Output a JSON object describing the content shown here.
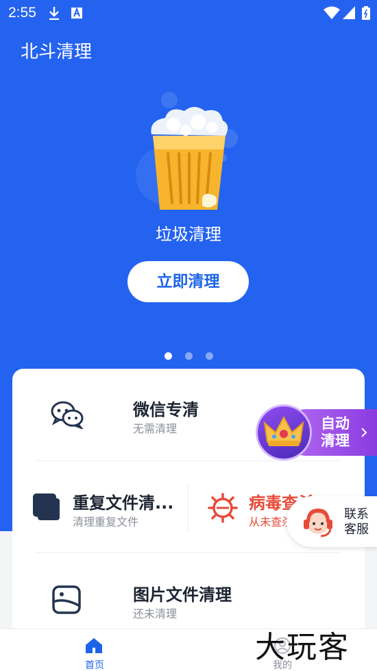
{
  "status_bar": {
    "time": "2:55",
    "icons": [
      "download-icon",
      "font-icon",
      "wifi-icon",
      "signal-icon",
      "battery-icon"
    ]
  },
  "app": {
    "title": "北斗清理"
  },
  "hero": {
    "label": "垃圾清理",
    "button_label": "立即清理",
    "pager": {
      "count": 3,
      "active_index": 0
    }
  },
  "features": {
    "wechat": {
      "title": "微信专清",
      "subtitle": "无需清理"
    },
    "duplicate": {
      "title": "重复文件清...",
      "subtitle": "清理重复文件"
    },
    "virus": {
      "title": "病毒查杀",
      "subtitle": "从未查杀"
    },
    "images": {
      "title": "图片文件清理",
      "subtitle": "还未清理"
    }
  },
  "auto_clean": {
    "line1": "自动",
    "line2": "清理"
  },
  "customer_service": {
    "line1": "联系",
    "line2": "客服"
  },
  "nav": {
    "home_label": "首页",
    "mine_label": "我的",
    "active": "home"
  },
  "watermark": "大玩客",
  "colors": {
    "primary": "#2463f0",
    "accent_red": "#e84a3a",
    "purple": "#9a4fe8"
  }
}
